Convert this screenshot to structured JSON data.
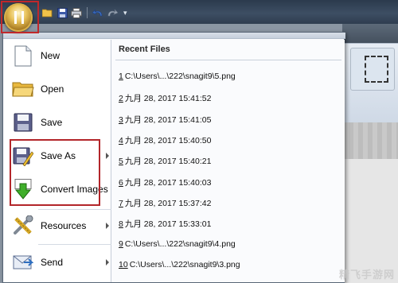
{
  "menu": {
    "items": [
      {
        "label": "New",
        "icon": "document-icon",
        "submenu": false
      },
      {
        "label": "Open",
        "icon": "folder-icon",
        "submenu": false
      },
      {
        "label": "Save",
        "icon": "floppy-icon",
        "submenu": false
      },
      {
        "label": "Save As",
        "icon": "floppy-pencil-icon",
        "submenu": true
      },
      {
        "label": "Convert Images",
        "icon": "green-arrow-icon",
        "submenu": false
      },
      {
        "label": "Resources",
        "icon": "tools-icon",
        "submenu": true
      },
      {
        "label": "Send",
        "icon": "envelope-icon",
        "submenu": true
      }
    ]
  },
  "recent": {
    "title": "Recent Files",
    "files": [
      {
        "num": "1",
        "name": "C:\\Users\\...\\222\\snagit9\\5.png"
      },
      {
        "num": "2",
        "name": "九月 28, 2017 15:41:52"
      },
      {
        "num": "3",
        "name": "九月 28, 2017 15:41:05"
      },
      {
        "num": "4",
        "name": "九月 28, 2017 15:40:50"
      },
      {
        "num": "5",
        "name": "九月 28, 2017 15:40:21"
      },
      {
        "num": "6",
        "name": "九月 28, 2017 15:40:03"
      },
      {
        "num": "7",
        "name": "九月 28, 2017 15:37:42"
      },
      {
        "num": "8",
        "name": "九月 28, 2017 15:33:01"
      },
      {
        "num": "9",
        "name": "C:\\Users\\...\\222\\snagit9\\4.png"
      },
      {
        "num": "10",
        "name": "C:\\Users\\...\\222\\snagit9\\3.png"
      }
    ]
  },
  "watermark": "精飞手游网",
  "colors": {
    "highlight": "#b3262a",
    "menu_bg": "#fafbfd",
    "titlebar": "#2f3d50"
  }
}
